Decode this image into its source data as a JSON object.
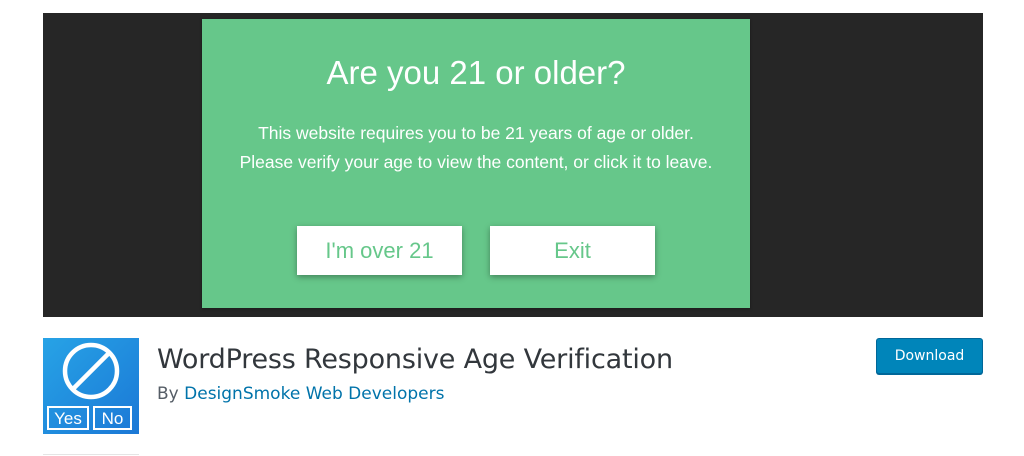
{
  "banner": {
    "modal": {
      "title": "Are you 21 or older?",
      "text": "This website requires you to be 21 years of age or older. Please verify your age to view the content, or click it to leave.",
      "confirm_label": "I'm over 21",
      "exit_label": "Exit"
    }
  },
  "plugin": {
    "icon": {
      "name": "no-symbol-icon",
      "yes_label": "Yes",
      "no_label": "No"
    },
    "title": "WordPress Responsive Age Verification",
    "by_prefix": "By",
    "author": "DesignSmoke Web Developers",
    "download_label": "Download"
  },
  "colors": {
    "banner_bg": "#262626",
    "modal_bg": "#66c78a",
    "accent_blue": "#0085ba",
    "link_blue": "#0073aa"
  }
}
